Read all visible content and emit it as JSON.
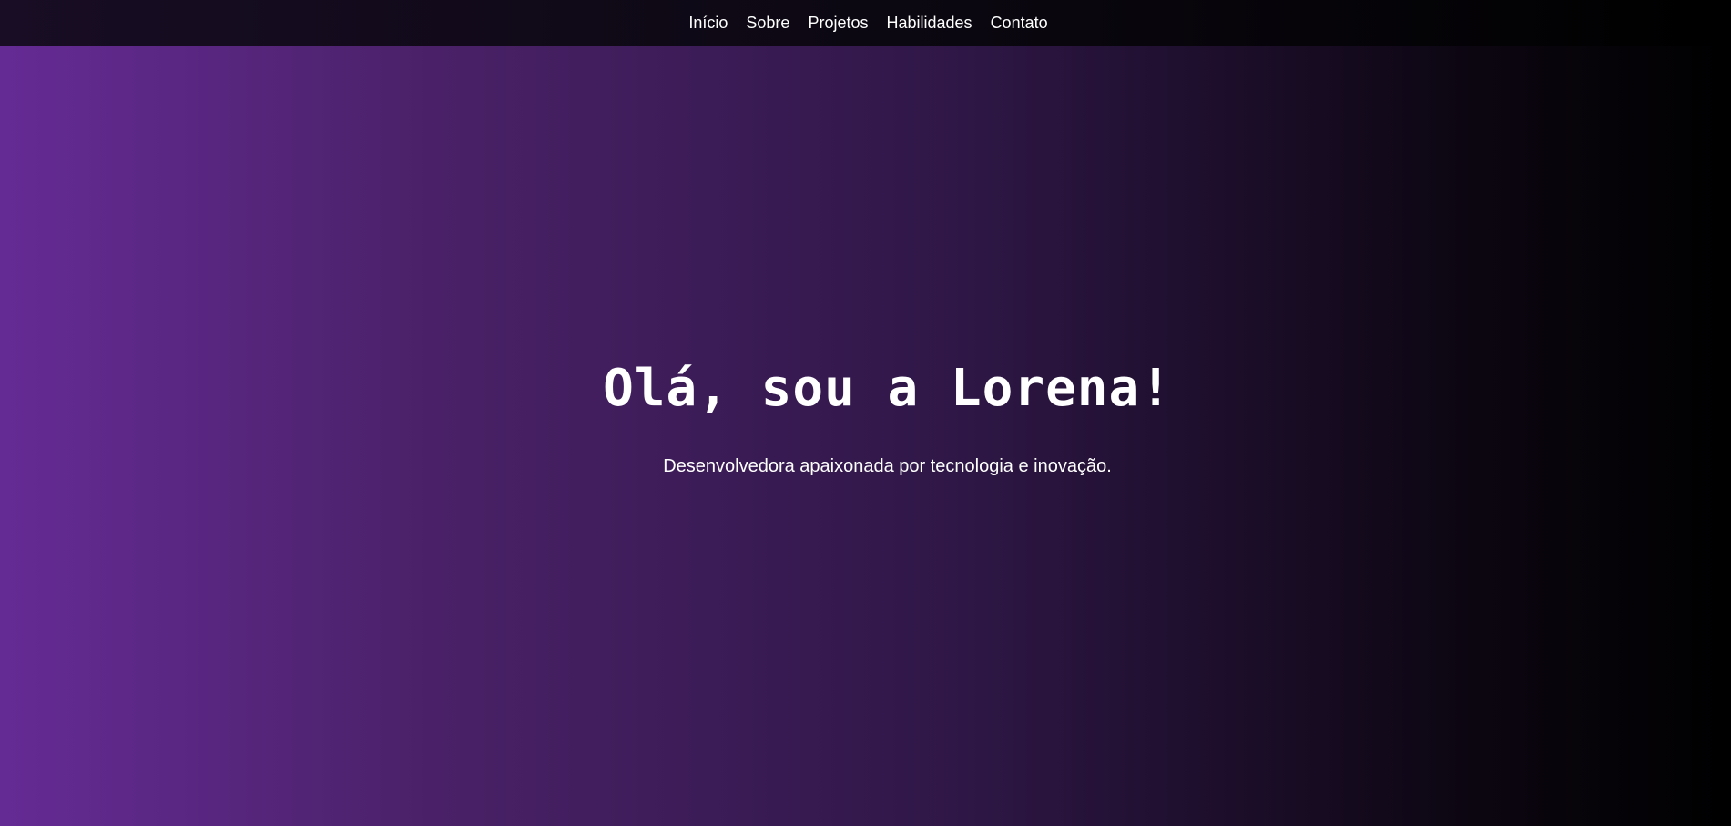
{
  "nav": {
    "items": [
      {
        "label": "Início"
      },
      {
        "label": "Sobre"
      },
      {
        "label": "Projetos"
      },
      {
        "label": "Habilidades"
      },
      {
        "label": "Contato"
      }
    ]
  },
  "hero": {
    "title": "Olá, sou a Lorena!",
    "subtitle": "Desenvolvedora apaixonada por tecnologia e inovação."
  },
  "colors": {
    "gradient_start": "#652b95",
    "gradient_end": "#000000",
    "nav_background": "#0c0812",
    "text": "#ffffff"
  }
}
